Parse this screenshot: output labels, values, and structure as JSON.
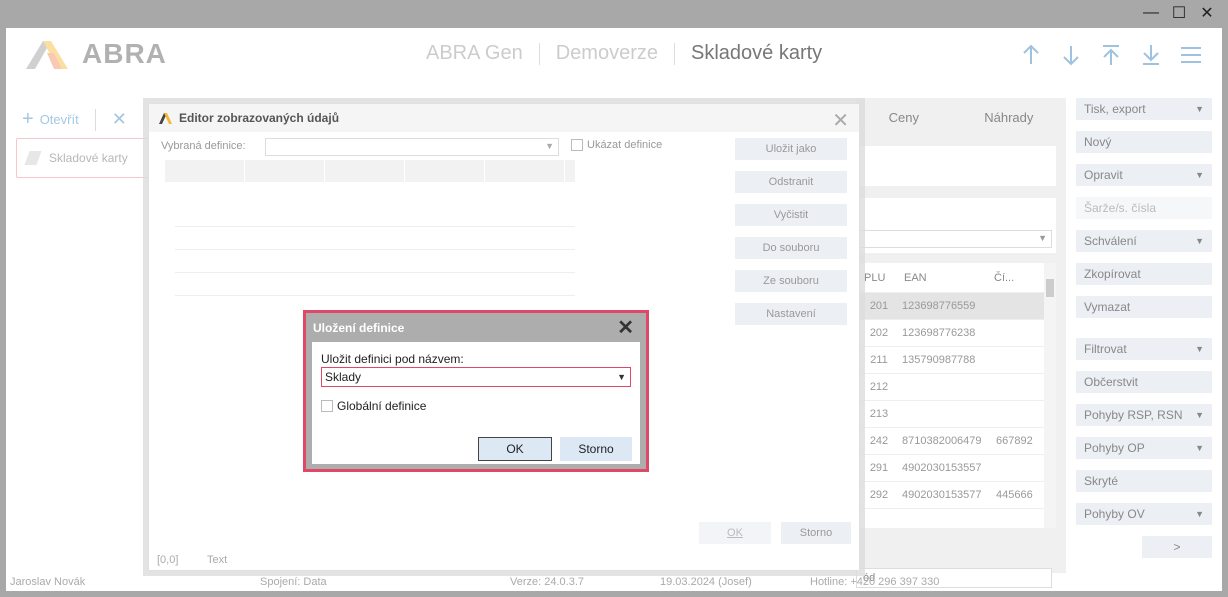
{
  "window": {
    "minimize": "—",
    "maximize": "☐",
    "close": "✕"
  },
  "header": {
    "logo": "ABRA",
    "breadcrumb": [
      "ABRA Gen",
      "Demoverze",
      "Skladové karty"
    ]
  },
  "toolbar": {
    "open_label": "Otevřít"
  },
  "left_tab": {
    "label": "Skladové karty"
  },
  "tabs": [
    "Ceny",
    "Náhrady"
  ],
  "grid": {
    "headers": [
      "PLU",
      "EAN",
      "Čí..."
    ],
    "rows": [
      [
        "201",
        "123698776559",
        ""
      ],
      [
        "202",
        "123698776238",
        ""
      ],
      [
        "211",
        "135790987788",
        ""
      ],
      [
        "212",
        "",
        ""
      ],
      [
        "213",
        "",
        ""
      ],
      [
        "242",
        "8710382006479",
        "667892"
      ],
      [
        "291",
        "4902030153557",
        ""
      ],
      [
        "292",
        "4902030153577",
        "445666"
      ]
    ],
    "bottom_select": "ód"
  },
  "right_panel": [
    {
      "label": "Tisk, export",
      "dropdown": true,
      "disabled": false
    },
    {
      "label": "Nový",
      "dropdown": false,
      "disabled": false
    },
    {
      "label": "Opravit",
      "dropdown": true,
      "disabled": false
    },
    {
      "label": "Šarže/s. čísla",
      "dropdown": false,
      "disabled": true
    },
    {
      "label": "Schválení",
      "dropdown": true,
      "disabled": false
    },
    {
      "label": "Zkopírovat",
      "dropdown": false,
      "disabled": false
    },
    {
      "label": "Vymazat",
      "dropdown": false,
      "disabled": false
    },
    {
      "label": "Filtrovat",
      "dropdown": true,
      "disabled": false
    },
    {
      "label": "Občerstvit",
      "dropdown": false,
      "disabled": false
    },
    {
      "label": "Pohyby RSP, RSN",
      "dropdown": true,
      "disabled": false
    },
    {
      "label": "Pohyby OP",
      "dropdown": true,
      "disabled": false
    },
    {
      "label": "Skryté",
      "dropdown": false,
      "disabled": false
    },
    {
      "label": "Pohyby OV",
      "dropdown": true,
      "disabled": false
    }
  ],
  "right_panel_more": ">",
  "status": {
    "user": "Jaroslav Novák",
    "connection": "Spojení: Data",
    "version": "Verze: 24.0.3.7",
    "date": "19.03.2024 (Josef)",
    "hotline": "Hotline: +420 296 397 330"
  },
  "editor": {
    "title": "Editor zobrazovaných údajů",
    "selected_label": "Vybraná definice:",
    "selected_value": "",
    "show_definitions": "Ukázat definice",
    "buttons": [
      "Uložit jako",
      "Odstranit",
      "Vyčistit",
      "Do souboru",
      "Ze souboru",
      "Nastavení"
    ],
    "ok": "OK",
    "cancel": "Storno",
    "coord": "[0,0]",
    "text_label": "Text"
  },
  "save_dialog": {
    "title": "Uložení definice",
    "name_label": "Uložit definici pod názvem:",
    "name_value": "Sklady",
    "global_label": "Globální definice",
    "global_checked": false,
    "ok": "OK",
    "cancel": "Storno"
  }
}
